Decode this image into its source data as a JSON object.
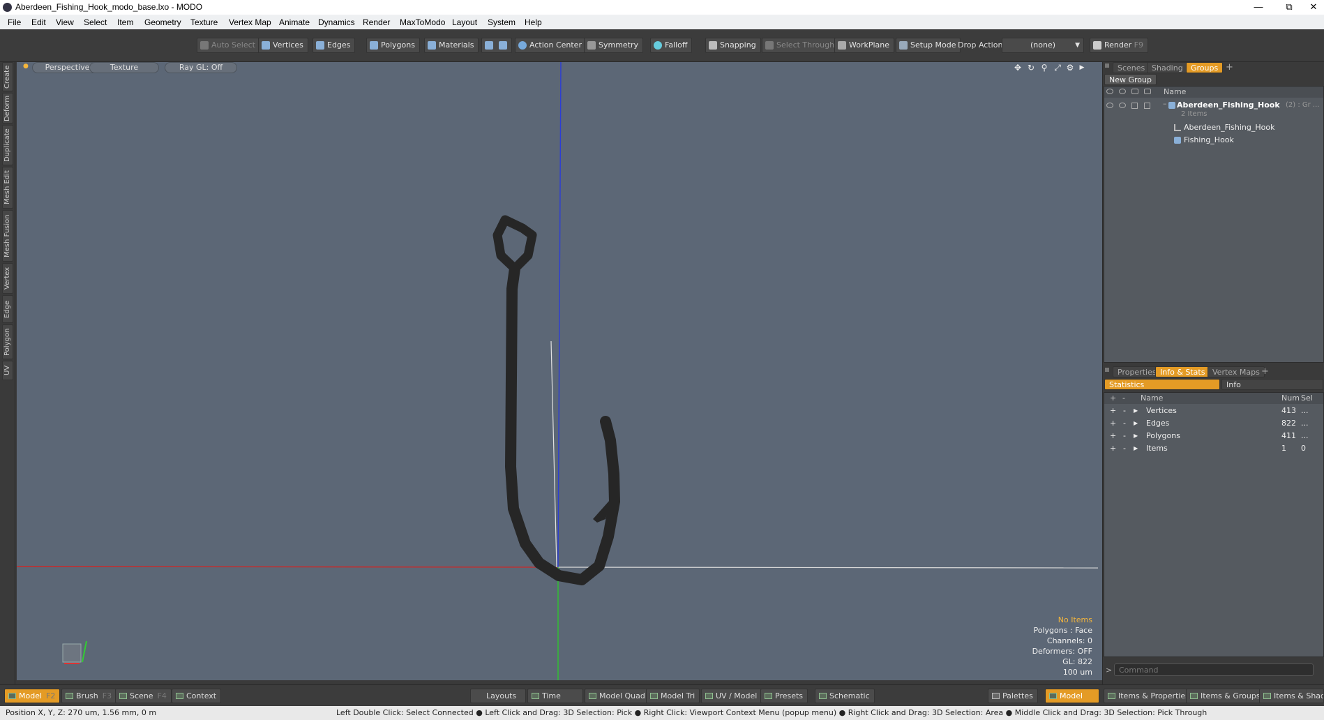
{
  "window": {
    "title": "Aberdeen_Fishing_Hook_modo_base.lxo - MODO"
  },
  "menu": [
    "File",
    "Edit",
    "View",
    "Select",
    "Item",
    "Geometry",
    "Texture",
    "Vertex Map",
    "Animate",
    "Dynamics",
    "Render",
    "MaxToModo",
    "Layout",
    "System",
    "Help"
  ],
  "toolbar": {
    "auto_select": "Auto Select",
    "vertices": "Vertices",
    "edges": "Edges",
    "polygons": "Polygons",
    "materials": "Materials",
    "action_center": "Action Center",
    "symmetry": "Symmetry",
    "falloff": "Falloff",
    "snapping": "Snapping",
    "select_through": "Select Through",
    "workplane": "WorkPlane",
    "setup_mode": "Setup Mode",
    "drop_action": "Drop Action",
    "drop_value": "(none)",
    "render": "Render",
    "render_key": "F9"
  },
  "left_tabs": [
    "Create",
    "Deform",
    "Duplicate",
    "Mesh Edit",
    "Mesh Fusion",
    "Vertex",
    "Edge",
    "Polygon",
    "UV"
  ],
  "viewport": {
    "view": "Perspective",
    "shading": "Texture",
    "raygl": "Ray GL: Off",
    "stats": {
      "items": "No Items",
      "polygons": "Polygons : Face",
      "channels": "Channels: 0",
      "deformers": "Deformers: OFF",
      "gl": "GL: 822",
      "scale": "100 um"
    }
  },
  "groups_panel": {
    "tabs": [
      "Scenes",
      "Shading",
      "Groups"
    ],
    "active_tab": "Groups",
    "new_group": "New Group",
    "col_name": "Name",
    "root": {
      "name": "Aberdeen_Fishing_Hook",
      "suffix": "(2) : Gr ...",
      "sub": "2 Items"
    },
    "children": [
      "Aberdeen_Fishing_Hook",
      "Fishing_Hook"
    ]
  },
  "info_panel": {
    "tabs": [
      "Properties",
      "Info & Stats",
      "Vertex Maps"
    ],
    "active_tab": "Info & Stats",
    "subtabs": [
      "Statistics",
      "Info"
    ],
    "cols": {
      "name": "Name",
      "num": "Num",
      "sel": "Sel"
    },
    "rows": [
      {
        "name": "Vertices",
        "num": "413",
        "sel": "..."
      },
      {
        "name": "Edges",
        "num": "822",
        "sel": "..."
      },
      {
        "name": "Polygons",
        "num": "411",
        "sel": "..."
      },
      {
        "name": "Items",
        "num": "1",
        "sel": "0"
      }
    ],
    "command_placeholder": "Command"
  },
  "bottombar": {
    "model": "Model",
    "model_key": "F2",
    "brush": "Brush",
    "brush_key": "F3",
    "scene": "Scene",
    "scene_key": "F4",
    "context": "Context",
    "layouts": "Layouts",
    "time": "Time",
    "model_quad": "Model Quad",
    "model_tri": "Model Tri",
    "uv_model": "UV / Model",
    "presets": "Presets",
    "schematic": "Schematic",
    "palettes": "Palettes",
    "model2": "Model",
    "items_props": "Items & Properties",
    "items_groups": "Items & Groups",
    "items_shading": "Items & Shadir"
  },
  "statusbar": {
    "position": "Position X, Y, Z:  270 um, 1.56 mm, 0 m",
    "hints": "Left Double Click: Select Connected ● Left Click and Drag: 3D Selection: Pick ● Right Click: Viewport Context Menu (popup menu) ● Right Click and Drag: 3D Selection: Area ● Middle Click and Drag: 3D Selection: Pick Through"
  }
}
